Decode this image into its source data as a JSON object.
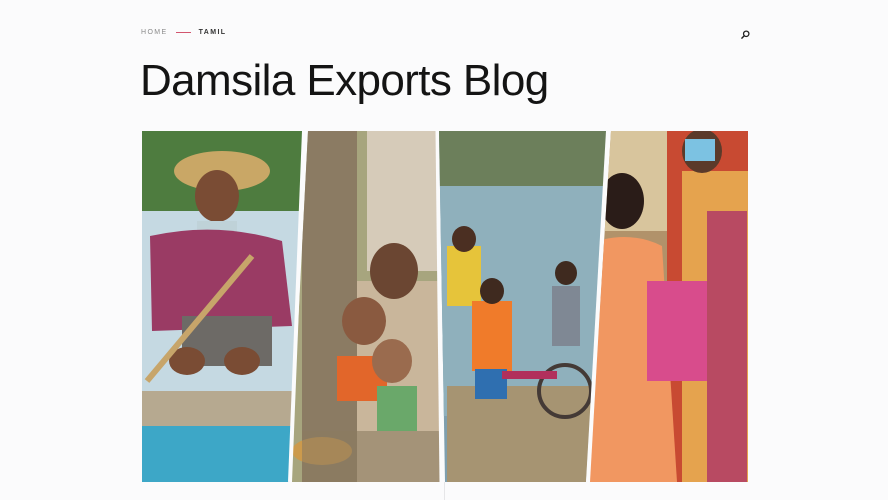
{
  "breadcrumb": {
    "home_label": "HOME",
    "current_label": "TAMIL"
  },
  "header": {
    "search_icon": "search-icon"
  },
  "page": {
    "title": "Damsila Exports Blog"
  },
  "hero_image": {
    "panels": [
      "fisherman-rowing-boat",
      "children-playing-outdoors",
      "boys-on-bamboo-raft",
      "girl-with-masked-woman"
    ]
  },
  "colors": {
    "accent": "#d2556e",
    "title": "#141414",
    "background": "#fbfbfc"
  }
}
